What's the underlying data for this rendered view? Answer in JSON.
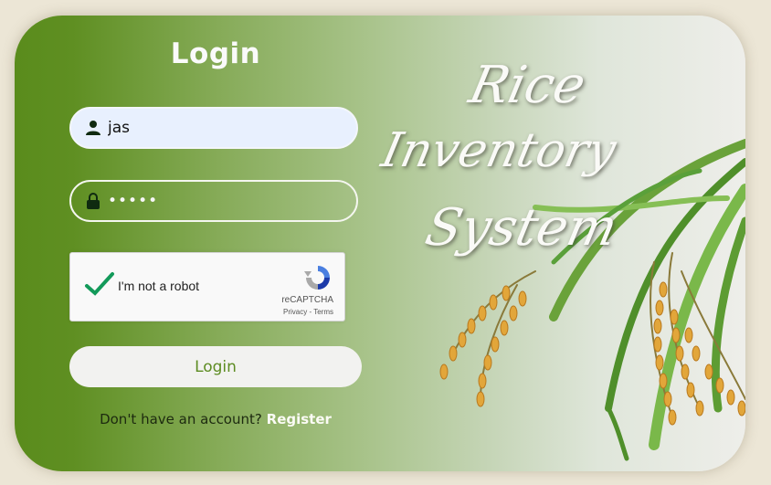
{
  "login": {
    "title": "Login",
    "username_value": "jas",
    "password_value": "•••••",
    "button_label": "Login",
    "footer_text": "Don't have an account?",
    "register_link": "Register"
  },
  "captcha": {
    "label": "I'm not a robot",
    "brand": "reCAPTCHA",
    "privacy": "Privacy",
    "separator": " - ",
    "terms": "Terms",
    "checked": true
  },
  "hero": {
    "line1": "Rice",
    "line2": "Inventory",
    "line3": "System"
  },
  "colors": {
    "accent_green": "#5d8c22",
    "white": "#fafafa"
  },
  "icons": {
    "user": "user-icon",
    "lock": "lock-icon",
    "check": "checkmark-icon",
    "recaptcha": "recaptcha-logo-icon"
  }
}
